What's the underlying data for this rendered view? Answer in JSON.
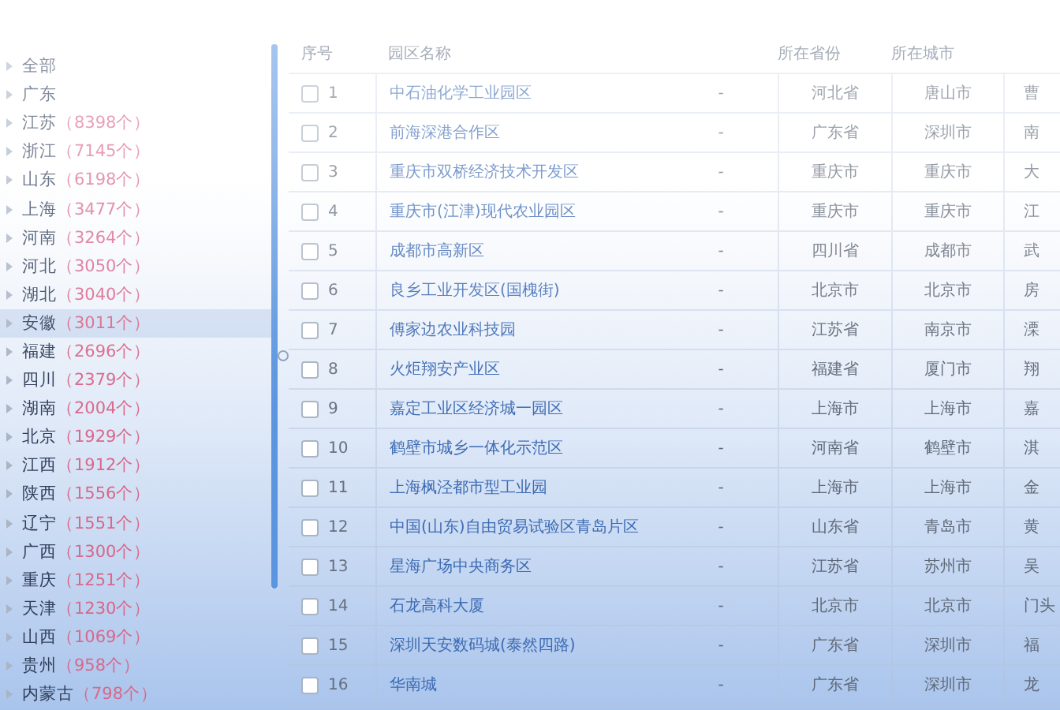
{
  "sidebar": {
    "items": [
      {
        "name": "全部",
        "selected": false
      },
      {
        "name": "广东",
        "selected": false
      },
      {
        "name": "江苏",
        "count": "（8398个）",
        "selected": false
      },
      {
        "name": "浙江",
        "count": "（7145个）",
        "selected": false
      },
      {
        "name": "山东",
        "count": "（6198个）",
        "selected": false
      },
      {
        "name": "上海",
        "count": "（3477个）",
        "selected": false
      },
      {
        "name": "河南",
        "count": "（3264个）",
        "selected": false
      },
      {
        "name": "河北",
        "count": "（3050个）",
        "selected": false
      },
      {
        "name": "湖北",
        "count": "（3040个）",
        "selected": false
      },
      {
        "name": "安徽",
        "count": "（3011个）",
        "selected": true
      },
      {
        "name": "福建",
        "count": "（2696个）",
        "selected": false
      },
      {
        "name": "四川",
        "count": "（2379个）",
        "selected": false
      },
      {
        "name": "湖南",
        "count": "（2004个）",
        "selected": false
      },
      {
        "name": "北京",
        "count": "（1929个）",
        "selected": false
      },
      {
        "name": "江西",
        "count": "（1912个）",
        "selected": false
      },
      {
        "name": "陕西",
        "count": "（1556个）",
        "selected": false
      },
      {
        "name": "辽宁",
        "count": "（1551个）",
        "selected": false
      },
      {
        "name": "广西",
        "count": "（1300个）",
        "selected": false
      },
      {
        "name": "重庆",
        "count": "（1251个）",
        "selected": false
      },
      {
        "name": "天津",
        "count": "（1230个）",
        "selected": false
      },
      {
        "name": "山西",
        "count": "（1069个）",
        "selected": false
      },
      {
        "name": "贵州",
        "count": "（958个）",
        "selected": false
      },
      {
        "name": "内蒙古",
        "count": "（798个）",
        "selected": false
      }
    ]
  },
  "table": {
    "columns": [
      "序号",
      "园区名称",
      "",
      "所在省份",
      "所在城市",
      ""
    ],
    "rows": [
      {
        "index": "1",
        "name": "中石油化学工业园区",
        "column_3": "-",
        "province": "河北省",
        "city": "唐山市",
        "column_6": "曹",
        "checked": false
      },
      {
        "index": "2",
        "name": "前海深港合作区",
        "column_3": "-",
        "province": "广东省",
        "city": "深圳市",
        "column_6": "南",
        "checked": false
      },
      {
        "index": "3",
        "name": "重庆市双桥经济技术开发区",
        "column_3": "-",
        "province": "重庆市",
        "city": "重庆市",
        "column_6": "大",
        "checked": false
      },
      {
        "index": "4",
        "name": "重庆市(江津)现代农业园区",
        "column_3": "-",
        "province": "重庆市",
        "city": "重庆市",
        "column_6": "江",
        "checked": false
      },
      {
        "index": "5",
        "name": "成都市高新区",
        "column_3": "-",
        "province": "四川省",
        "city": "成都市",
        "column_6": "武",
        "checked": false
      },
      {
        "index": "6",
        "name": "良乡工业开发区(国槐街)",
        "column_3": "-",
        "province": "北京市",
        "city": "北京市",
        "column_6": "房",
        "checked": false
      },
      {
        "index": "7",
        "name": "傅家边农业科技园",
        "column_3": "-",
        "province": "江苏省",
        "city": "南京市",
        "column_6": "溧",
        "checked": false
      },
      {
        "index": "8",
        "name": "火炬翔安产业区",
        "column_3": "-",
        "province": "福建省",
        "city": "厦门市",
        "column_6": "翔",
        "checked": false
      },
      {
        "index": "9",
        "name": "嘉定工业区经济城一园区",
        "column_3": "-",
        "province": "上海市",
        "city": "上海市",
        "column_6": "嘉",
        "checked": false
      },
      {
        "index": "10",
        "name": "鹤壁市城乡一体化示范区",
        "column_3": "-",
        "province": "河南省",
        "city": "鹤壁市",
        "column_6": "淇",
        "checked": false
      },
      {
        "index": "11",
        "name": "上海枫泾都市型工业园",
        "column_3": "-",
        "province": "上海市",
        "city": "上海市",
        "column_6": "金",
        "checked": false
      },
      {
        "index": "12",
        "name": "中国(山东)自由贸易试验区青岛片区",
        "column_3": "-",
        "province": "山东省",
        "city": "青岛市",
        "column_6": "黄",
        "checked": false
      },
      {
        "index": "13",
        "name": "星海广场中央商务区",
        "column_3": "-",
        "province": "江苏省",
        "city": "苏州市",
        "column_6": "吴",
        "checked": false
      },
      {
        "index": "14",
        "name": "石龙高科大厦",
        "column_3": "-",
        "province": "北京市",
        "city": "北京市",
        "column_6": "门头",
        "checked": false
      },
      {
        "index": "15",
        "name": "深圳天安数码城(泰然四路)",
        "column_3": "-",
        "province": "广东省",
        "city": "深圳市",
        "column_6": "福",
        "checked": false
      },
      {
        "index": "16",
        "name": "华南城",
        "column_3": "-",
        "province": "广东省",
        "city": "深圳市",
        "column_6": "龙",
        "checked": false
      }
    ]
  }
}
